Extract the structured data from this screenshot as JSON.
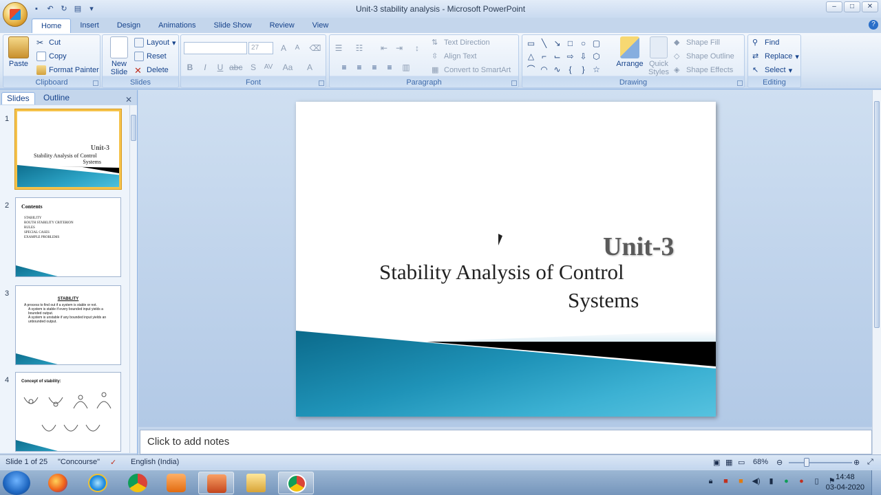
{
  "window": {
    "title": "Unit-3 stability analysis - Microsoft PowerPoint"
  },
  "tabs": [
    "Home",
    "Insert",
    "Design",
    "Animations",
    "Slide Show",
    "Review",
    "View"
  ],
  "active_tab": "Home",
  "ribbon": {
    "clipboard": {
      "label": "Clipboard",
      "paste": "Paste",
      "cut": "Cut",
      "copy": "Copy",
      "format_painter": "Format Painter"
    },
    "slides": {
      "label": "Slides",
      "new_slide": "New Slide",
      "layout": "Layout",
      "reset": "Reset",
      "delete": "Delete"
    },
    "font": {
      "label": "Font",
      "font_name": "",
      "font_size": "27"
    },
    "paragraph": {
      "label": "Paragraph",
      "text_direction": "Text Direction",
      "align_text": "Align Text",
      "convert_smartart": "Convert to SmartArt"
    },
    "drawing": {
      "label": "Drawing",
      "arrange": "Arrange",
      "quick_styles": "Quick Styles",
      "shape_fill": "Shape Fill",
      "shape_outline": "Shape Outline",
      "shape_effects": "Shape Effects"
    },
    "editing": {
      "label": "Editing",
      "find": "Find",
      "replace": "Replace",
      "select": "Select"
    }
  },
  "slide_pane": {
    "tabs": [
      "Slides",
      "Outline"
    ],
    "thumbnails": [
      {
        "num": "1",
        "title": "Unit-3",
        "line1": "Stability Analysis of Control",
        "line2": "Systems"
      },
      {
        "num": "2",
        "title": "Contents",
        "bullets": [
          "STABILITY",
          "ROUTH STABILITY CRITERION",
          "RULES",
          "SPECIAL CASES",
          "EXAMPLE PROBLEMS"
        ]
      },
      {
        "num": "3",
        "title": "STABILITY",
        "bullets": [
          "A process to find out if a system is stable or not.",
          "A system is stable if every bounded input yields a bounded output.",
          "A system is unstable if any bounded input yields an unbounded output."
        ]
      },
      {
        "num": "4",
        "title": "Concept of stability:"
      }
    ]
  },
  "slide": {
    "title": "Unit-3",
    "subtitle_line1": "Stability Analysis  of Control",
    "subtitle_line2": "Systems"
  },
  "notes": {
    "placeholder": "Click to add notes"
  },
  "status": {
    "slide_info": "Slide 1 of 25",
    "theme": "\"Concourse\"",
    "language": "English (India)",
    "zoom": "68%",
    "zoom_fraction": 0.28
  },
  "taskbar": {
    "time": "14:48",
    "date": "03-04-2020"
  }
}
